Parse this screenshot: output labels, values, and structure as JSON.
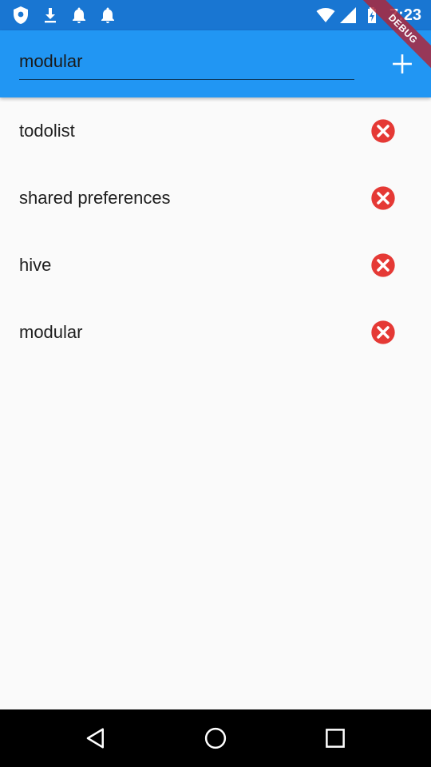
{
  "status_bar": {
    "time": "7:23",
    "background": "#1976d2",
    "left_icons": [
      "shield-icon",
      "download-icon",
      "notification-bell-icon",
      "notification-bell-icon"
    ],
    "right_icons": [
      "wifi-icon",
      "cellular-signal-icon",
      "battery-charging-icon"
    ]
  },
  "app_bar": {
    "background": "#2196f3",
    "input_value": "modular",
    "add_icon": "plus-icon"
  },
  "debug_banner": {
    "label": "DEBUG"
  },
  "todos": [
    {
      "label": "todolist"
    },
    {
      "label": "shared preferences"
    },
    {
      "label": "hive"
    },
    {
      "label": "modular"
    }
  ],
  "delete_icon": "cancel-circle-icon",
  "delete_color": "#e53935",
  "nav_bar": {
    "buttons": [
      "back-icon",
      "home-icon",
      "recents-icon"
    ]
  }
}
